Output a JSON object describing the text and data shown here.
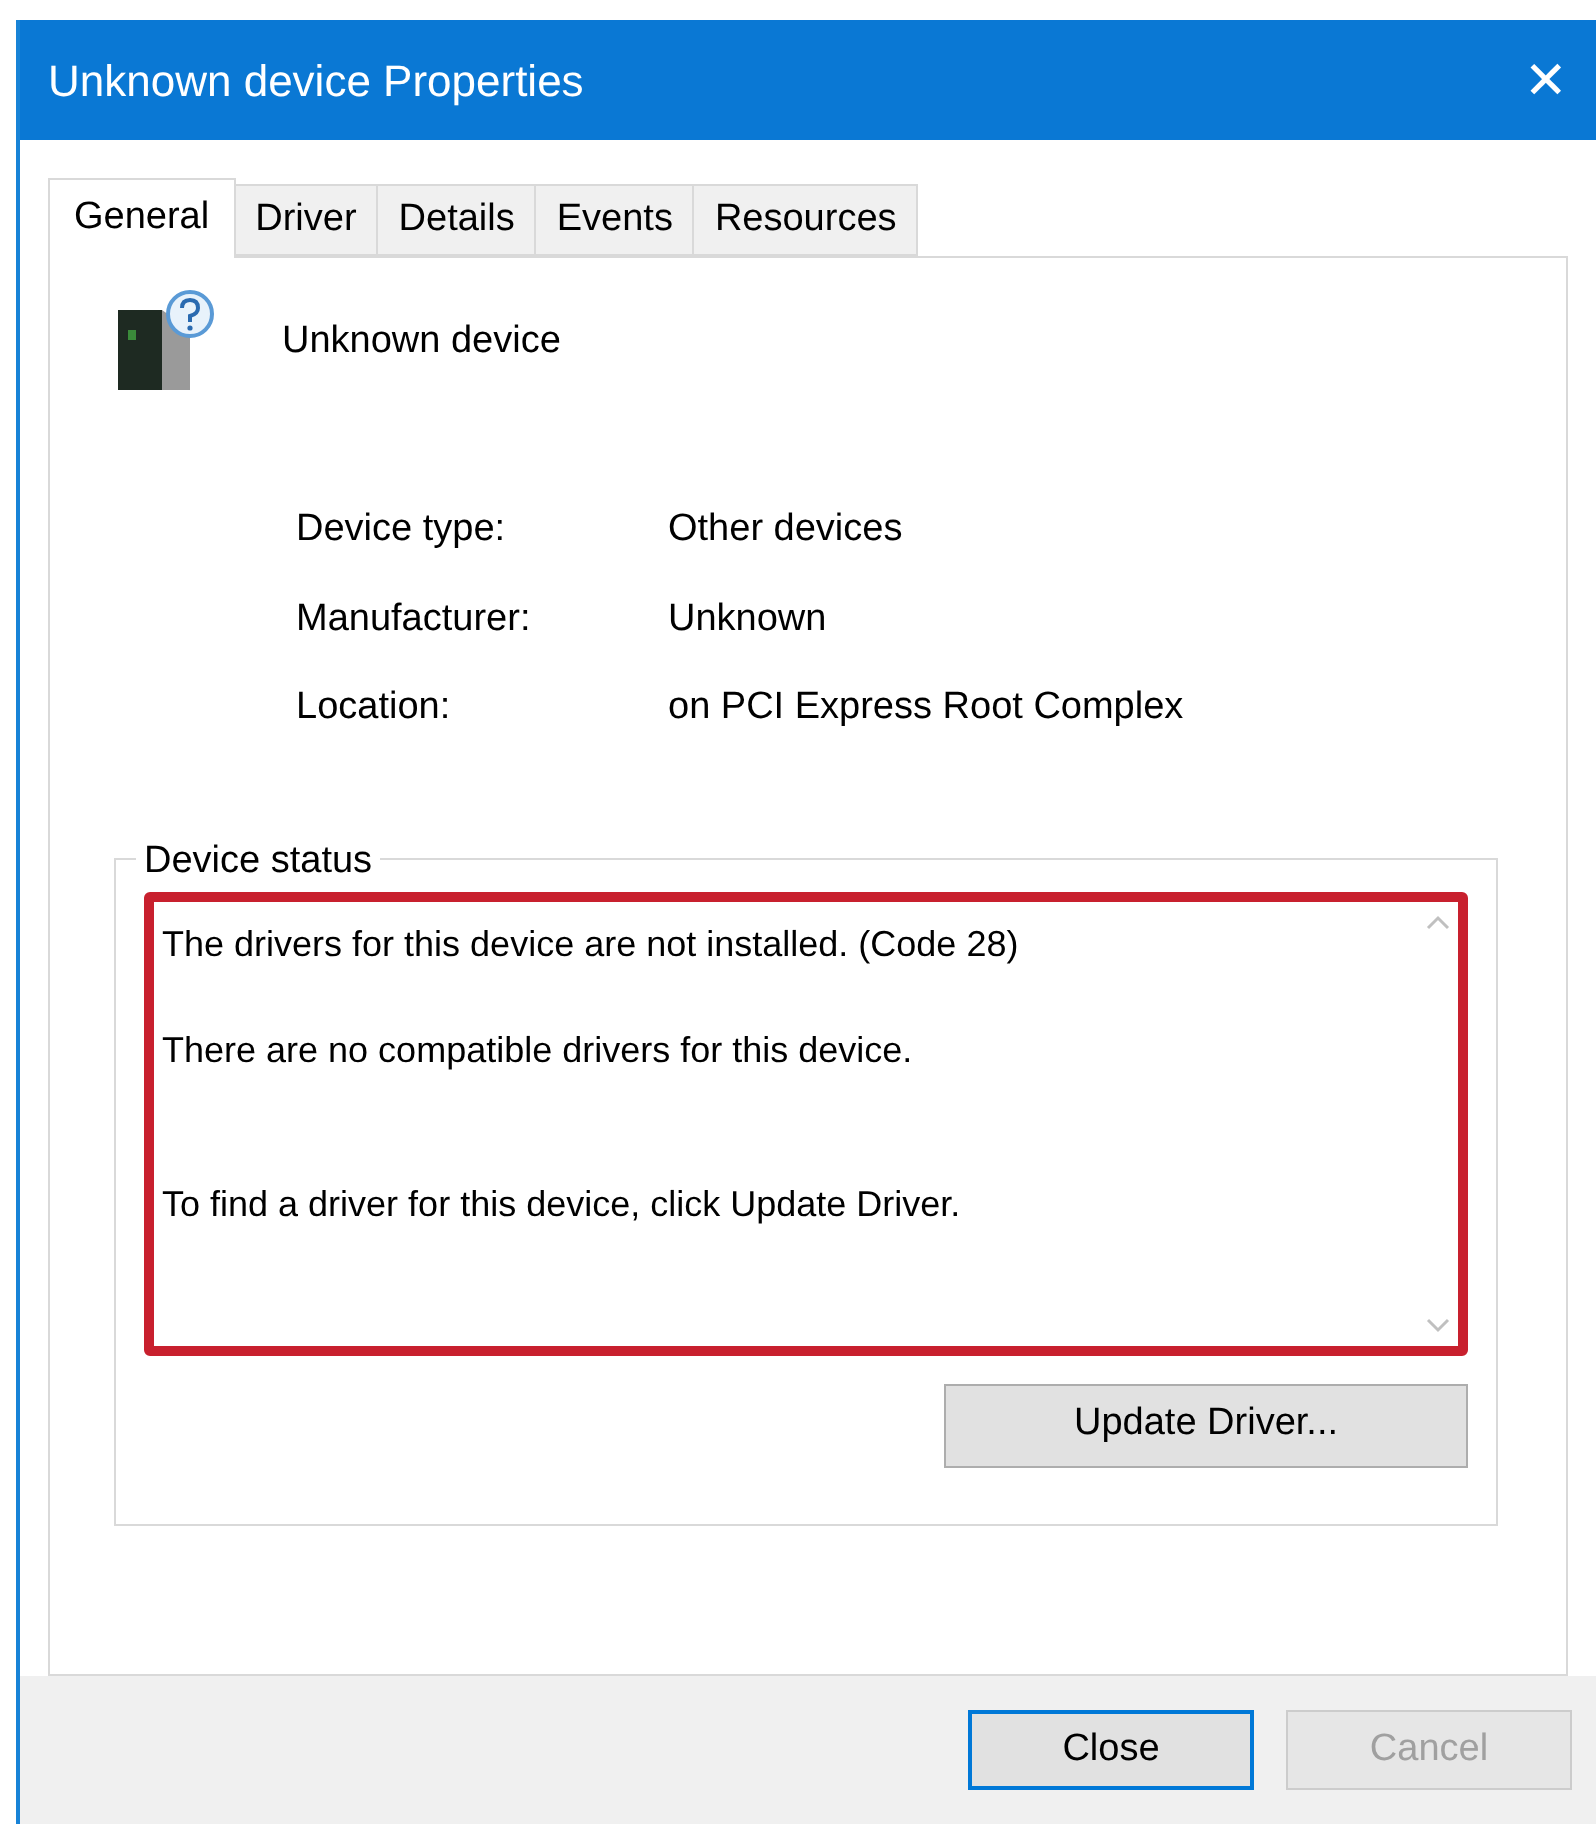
{
  "window": {
    "title": "Unknown device Properties",
    "close_glyph": "✕"
  },
  "tabs": [
    {
      "label": "General",
      "selected": true
    },
    {
      "label": "Driver",
      "selected": false
    },
    {
      "label": "Details",
      "selected": false
    },
    {
      "label": "Events",
      "selected": false
    },
    {
      "label": "Resources",
      "selected": false
    }
  ],
  "device": {
    "name": "Unknown device"
  },
  "properties": [
    {
      "label": "Device type:",
      "value": "Other devices"
    },
    {
      "label": "Manufacturer:",
      "value": "Unknown"
    },
    {
      "label": "Location:",
      "value": "on PCI Express Root Complex"
    }
  ],
  "device_status": {
    "title": "Device status",
    "highlighted": true,
    "lines": [
      "The drivers for this device are not installed. (Code 28)",
      "There are no compatible drivers for this device.",
      "To find a driver for this device, click Update Driver."
    ]
  },
  "update_button": {
    "label": "Update Driver..."
  },
  "buttons": [
    {
      "label": "Close",
      "disabled": false,
      "default": true
    },
    {
      "label": "Cancel",
      "disabled": true,
      "default": false
    }
  ]
}
